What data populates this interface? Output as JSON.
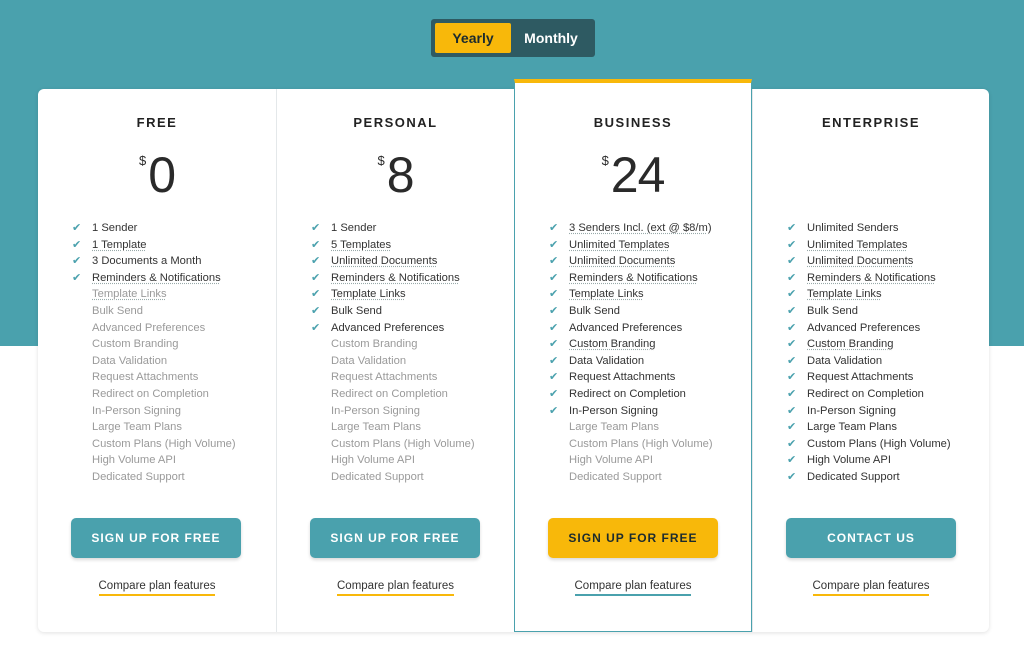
{
  "billing_toggle": {
    "yearly": "Yearly",
    "monthly": "Monthly",
    "selected": "Yearly"
  },
  "colors": {
    "teal": "#4aa1ad",
    "yellow": "#f8b80a",
    "dark_toggle": "#2e5a62"
  },
  "plans": [
    {
      "name": "FREE",
      "currency": "$",
      "price": "0",
      "cta": "SIGN UP FOR FREE",
      "compare": "Compare plan features",
      "features": [
        {
          "text": "1 Sender",
          "included": true
        },
        {
          "text": "1 Template",
          "included": true
        },
        {
          "text": "3 Documents a Month",
          "included": true
        },
        {
          "text": "Reminders & Notifications",
          "included": true
        },
        {
          "text": "Template Links",
          "included": false
        },
        {
          "text": "Bulk Send",
          "included": false
        },
        {
          "text": "Advanced Preferences",
          "included": false
        },
        {
          "text": "Custom Branding",
          "included": false
        },
        {
          "text": "Data Validation",
          "included": false
        },
        {
          "text": "Request Attachments",
          "included": false
        },
        {
          "text": "Redirect on Completion",
          "included": false
        },
        {
          "text": "In-Person Signing",
          "included": false
        },
        {
          "text": "Large Team Plans",
          "included": false
        },
        {
          "text": "Custom Plans (High Volume)",
          "included": false
        },
        {
          "text": "High Volume API",
          "included": false
        },
        {
          "text": "Dedicated Support",
          "included": false
        }
      ]
    },
    {
      "name": "PERSONAL",
      "currency": "$",
      "price": "8",
      "cta": "SIGN UP FOR FREE",
      "compare": "Compare plan features",
      "features": [
        {
          "text": "1 Sender",
          "included": true
        },
        {
          "text": "5 Templates",
          "included": true
        },
        {
          "text": "Unlimited Documents",
          "included": true
        },
        {
          "text": "Reminders & Notifications",
          "included": true
        },
        {
          "text": "Template Links",
          "included": true
        },
        {
          "text": "Bulk Send",
          "included": true
        },
        {
          "text": "Advanced Preferences",
          "included": true
        },
        {
          "text": "Custom Branding",
          "included": false
        },
        {
          "text": "Data Validation",
          "included": false
        },
        {
          "text": "Request Attachments",
          "included": false
        },
        {
          "text": "Redirect on Completion",
          "included": false
        },
        {
          "text": "In-Person Signing",
          "included": false
        },
        {
          "text": "Large Team Plans",
          "included": false
        },
        {
          "text": "Custom Plans (High Volume)",
          "included": false
        },
        {
          "text": "High Volume API",
          "included": false
        },
        {
          "text": "Dedicated Support",
          "included": false
        }
      ]
    },
    {
      "name": "BUSINESS",
      "currency": "$",
      "price": "24",
      "cta": "SIGN UP FOR FREE",
      "compare": "Compare plan features",
      "features": [
        {
          "text": "3 Senders Incl. (ext @ $8/m)",
          "included": true
        },
        {
          "text": "Unlimited Templates",
          "included": true
        },
        {
          "text": "Unlimited Documents",
          "included": true
        },
        {
          "text": "Reminders & Notifications",
          "included": true
        },
        {
          "text": "Template Links",
          "included": true
        },
        {
          "text": "Bulk Send",
          "included": true
        },
        {
          "text": "Advanced Preferences",
          "included": true
        },
        {
          "text": "Custom Branding",
          "included": true
        },
        {
          "text": "Data Validation",
          "included": true
        },
        {
          "text": "Request Attachments",
          "included": true
        },
        {
          "text": "Redirect on Completion",
          "included": true
        },
        {
          "text": "In-Person Signing",
          "included": true
        },
        {
          "text": "Large Team Plans",
          "included": false
        },
        {
          "text": "Custom Plans (High Volume)",
          "included": false
        },
        {
          "text": "High Volume API",
          "included": false
        },
        {
          "text": "Dedicated Support",
          "included": false
        }
      ]
    },
    {
      "name": "ENTERPRISE",
      "currency": "",
      "price": "",
      "cta": "CONTACT US",
      "compare": "Compare plan features",
      "features": [
        {
          "text": "Unlimited Senders",
          "included": true
        },
        {
          "text": "Unlimited Templates",
          "included": true
        },
        {
          "text": "Unlimited Documents",
          "included": true
        },
        {
          "text": "Reminders & Notifications",
          "included": true
        },
        {
          "text": "Template Links",
          "included": true
        },
        {
          "text": "Bulk Send",
          "included": true
        },
        {
          "text": "Advanced Preferences",
          "included": true
        },
        {
          "text": "Custom Branding",
          "included": true
        },
        {
          "text": "Data Validation",
          "included": true
        },
        {
          "text": "Request Attachments",
          "included": true
        },
        {
          "text": "Redirect on Completion",
          "included": true
        },
        {
          "text": "In-Person Signing",
          "included": true
        },
        {
          "text": "Large Team Plans",
          "included": true
        },
        {
          "text": "Custom Plans (High Volume)",
          "included": true
        },
        {
          "text": "High Volume API",
          "included": true
        },
        {
          "text": "Dedicated Support",
          "included": true
        }
      ]
    }
  ]
}
